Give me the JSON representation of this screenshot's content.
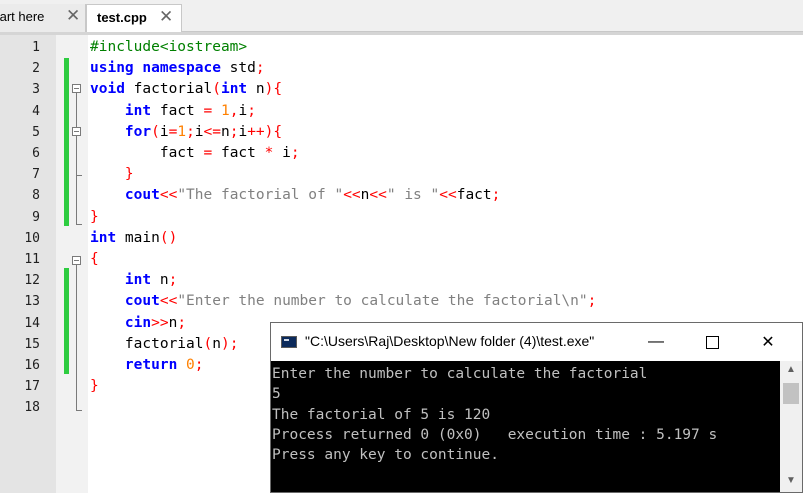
{
  "tabs": [
    {
      "label": "tart here",
      "close": "✕"
    },
    {
      "label": "test.cpp",
      "close": "✕"
    }
  ],
  "line_numbers": [
    "1",
    "2",
    "3",
    "4",
    "5",
    "6",
    "7",
    "8",
    "9",
    "10",
    "11",
    "12",
    "13",
    "14",
    "15",
    "16",
    "17",
    "18"
  ],
  "code_lines": [
    [
      {
        "t": "pp",
        "v": "#include<iostream>"
      }
    ],
    [
      {
        "t": "kw",
        "v": "using namespace"
      },
      {
        "t": "id",
        "v": " std"
      },
      {
        "t": "op",
        "v": ";"
      }
    ],
    [
      {
        "t": "kw",
        "v": "void"
      },
      {
        "t": "id",
        "v": " factorial"
      },
      {
        "t": "op",
        "v": "("
      },
      {
        "t": "kw",
        "v": "int"
      },
      {
        "t": "id",
        "v": " n"
      },
      {
        "t": "op",
        "v": "){"
      }
    ],
    [
      {
        "t": "id",
        "v": "    "
      },
      {
        "t": "kw",
        "v": "int"
      },
      {
        "t": "id",
        "v": " fact "
      },
      {
        "t": "op",
        "v": "="
      },
      {
        "t": "id",
        "v": " "
      },
      {
        "t": "num",
        "v": "1"
      },
      {
        "t": "op",
        "v": ","
      },
      {
        "t": "id",
        "v": "i"
      },
      {
        "t": "op",
        "v": ";"
      }
    ],
    [
      {
        "t": "id",
        "v": "    "
      },
      {
        "t": "kw",
        "v": "for"
      },
      {
        "t": "op",
        "v": "("
      },
      {
        "t": "id",
        "v": "i"
      },
      {
        "t": "op",
        "v": "="
      },
      {
        "t": "num",
        "v": "1"
      },
      {
        "t": "op",
        "v": ";"
      },
      {
        "t": "id",
        "v": "i"
      },
      {
        "t": "op",
        "v": "<="
      },
      {
        "t": "id",
        "v": "n"
      },
      {
        "t": "op",
        "v": ";"
      },
      {
        "t": "id",
        "v": "i"
      },
      {
        "t": "op",
        "v": "++){"
      }
    ],
    [
      {
        "t": "id",
        "v": "        fact "
      },
      {
        "t": "op",
        "v": "="
      },
      {
        "t": "id",
        "v": " fact "
      },
      {
        "t": "op",
        "v": "*"
      },
      {
        "t": "id",
        "v": " i"
      },
      {
        "t": "op",
        "v": ";"
      }
    ],
    [
      {
        "t": "id",
        "v": "    "
      },
      {
        "t": "op",
        "v": "}"
      }
    ],
    [
      {
        "t": "id",
        "v": "    "
      },
      {
        "t": "kw",
        "v": "cout"
      },
      {
        "t": "op",
        "v": "<<"
      },
      {
        "t": "str",
        "v": "\"The factorial of \""
      },
      {
        "t": "op",
        "v": "<<"
      },
      {
        "t": "id",
        "v": "n"
      },
      {
        "t": "op",
        "v": "<<"
      },
      {
        "t": "str",
        "v": "\" is \""
      },
      {
        "t": "op",
        "v": "<<"
      },
      {
        "t": "id",
        "v": "fact"
      },
      {
        "t": "op",
        "v": ";"
      }
    ],
    [
      {
        "t": "op",
        "v": "}"
      }
    ],
    [
      {
        "t": "kw",
        "v": "int"
      },
      {
        "t": "id",
        "v": " main"
      },
      {
        "t": "op",
        "v": "()"
      }
    ],
    [
      {
        "t": "op",
        "v": "{"
      }
    ],
    [
      {
        "t": "id",
        "v": "    "
      },
      {
        "t": "kw",
        "v": "int"
      },
      {
        "t": "id",
        "v": " n"
      },
      {
        "t": "op",
        "v": ";"
      }
    ],
    [
      {
        "t": "id",
        "v": "    "
      },
      {
        "t": "kw",
        "v": "cout"
      },
      {
        "t": "op",
        "v": "<<"
      },
      {
        "t": "str",
        "v": "\"Enter the number to calculate the factorial\\n\""
      },
      {
        "t": "op",
        "v": ";"
      }
    ],
    [
      {
        "t": "id",
        "v": "    "
      },
      {
        "t": "kw",
        "v": "cin"
      },
      {
        "t": "op",
        "v": ">>"
      },
      {
        "t": "id",
        "v": "n"
      },
      {
        "t": "op",
        "v": ";"
      }
    ],
    [
      {
        "t": "id",
        "v": "    factorial"
      },
      {
        "t": "op",
        "v": "("
      },
      {
        "t": "id",
        "v": "n"
      },
      {
        "t": "op",
        "v": ");"
      }
    ],
    [
      {
        "t": "id",
        "v": "    "
      },
      {
        "t": "kw",
        "v": "return"
      },
      {
        "t": "id",
        "v": " "
      },
      {
        "t": "num",
        "v": "0"
      },
      {
        "t": "op",
        "v": ";"
      }
    ],
    [
      {
        "t": "op",
        "v": "}"
      }
    ],
    []
  ],
  "console": {
    "title": "\"C:\\Users\\Raj\\Desktop\\New folder (4)\\test.exe\"",
    "minimize": "—",
    "maximize": "",
    "close": "✕",
    "lines": [
      "Enter the number to calculate the factorial",
      "5",
      "The factorial of 5 is 120",
      "Process returned 0 (0x0)   execution time : 5.197 s",
      "Press any key to continue."
    ],
    "scroll_up": "▲",
    "scroll_down": "▼"
  },
  "colors": {
    "keyword": "#0000ff",
    "preprocessor": "#008000",
    "operator": "#ff0000",
    "number": "#ff8000",
    "string": "#808080",
    "changed_line_marker": "#2ecc40"
  }
}
